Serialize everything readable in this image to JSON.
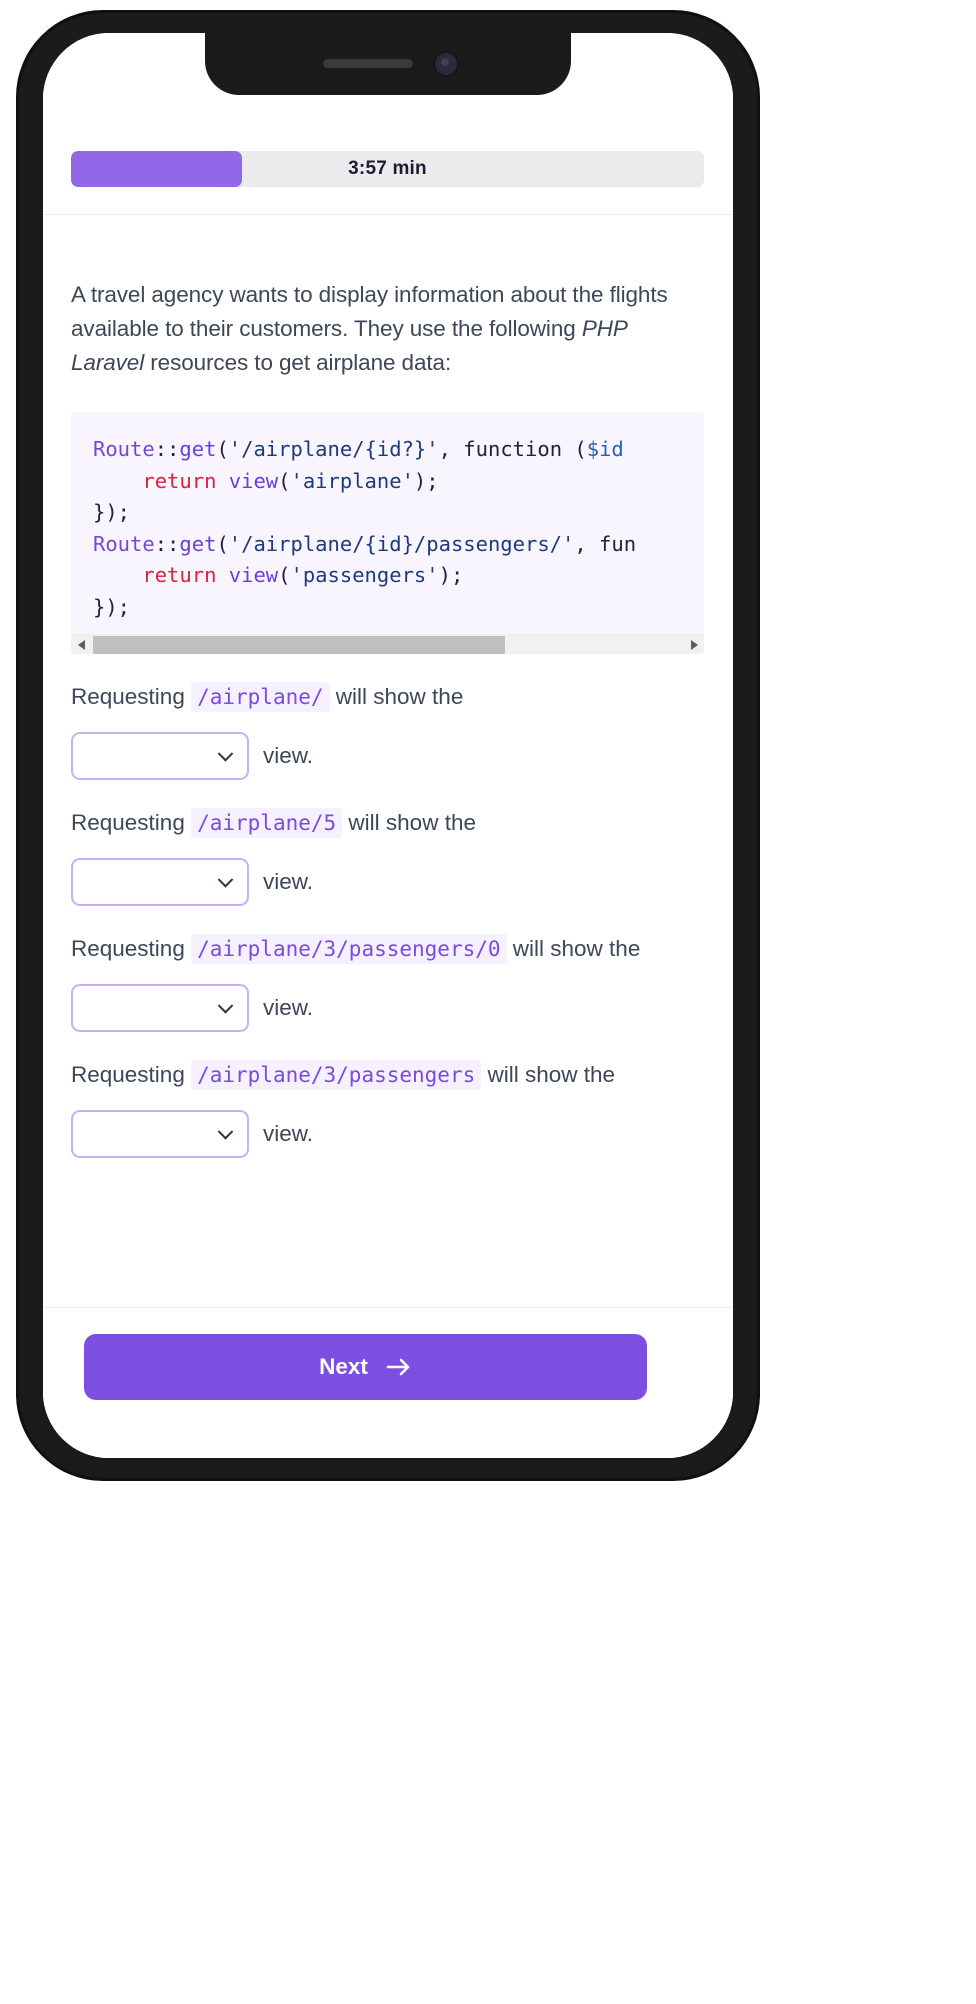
{
  "device": {
    "type": "smartphone-mockup",
    "notch_icons": [
      "speaker-grill",
      "front-camera"
    ]
  },
  "header": {
    "timer_label": "3:57 min",
    "progress_percent": 27,
    "progress_fill_color": "#9168e8",
    "progress_track_color": "#ebebee"
  },
  "prompt": {
    "part1": "A travel agency wants to display information about the flights available to their customers. They use the following ",
    "emphasis": "PHP Laravel",
    "part2": " resources to get airplane data:"
  },
  "code_block": {
    "language": "php",
    "background": "#f8f5fe",
    "lines": [
      {
        "tokens": [
          {
            "t": "Route",
            "c": "class"
          },
          {
            "t": "::",
            "c": "punct"
          },
          {
            "t": "get",
            "c": "fn"
          },
          {
            "t": "(",
            "c": "punct"
          },
          {
            "t": "'/airplane/{id?}'",
            "c": "str"
          },
          {
            "t": ", ",
            "c": "punct"
          },
          {
            "t": "function",
            "c": "punct"
          },
          {
            "t": " (",
            "c": "punct"
          },
          {
            "t": "$id",
            "c": "var"
          }
        ]
      },
      {
        "tokens": [
          {
            "t": "    ",
            "c": "punct"
          },
          {
            "t": "return",
            "c": "kw"
          },
          {
            "t": " ",
            "c": "punct"
          },
          {
            "t": "view",
            "c": "fn"
          },
          {
            "t": "(",
            "c": "punct"
          },
          {
            "t": "'airplane'",
            "c": "str"
          },
          {
            "t": ");",
            "c": "punct"
          }
        ]
      },
      {
        "tokens": [
          {
            "t": "});",
            "c": "punct"
          }
        ]
      },
      {
        "tokens": [
          {
            "t": "Route",
            "c": "class"
          },
          {
            "t": "::",
            "c": "punct"
          },
          {
            "t": "get",
            "c": "fn"
          },
          {
            "t": "(",
            "c": "punct"
          },
          {
            "t": "'/airplane/{id}/passengers/'",
            "c": "str"
          },
          {
            "t": ", ",
            "c": "punct"
          },
          {
            "t": "fun",
            "c": "punct"
          }
        ]
      },
      {
        "tokens": [
          {
            "t": "    ",
            "c": "punct"
          },
          {
            "t": "return",
            "c": "kw"
          },
          {
            "t": " ",
            "c": "punct"
          },
          {
            "t": "view",
            "c": "fn"
          },
          {
            "t": "(",
            "c": "punct"
          },
          {
            "t": "'passengers'",
            "c": "str"
          },
          {
            "t": ");",
            "c": "punct"
          }
        ]
      },
      {
        "tokens": [
          {
            "t": "});",
            "c": "punct"
          }
        ]
      }
    ],
    "scrollbar": {
      "left_arrow": "triangle-left-icon",
      "right_arrow": "triangle-right-icon",
      "thumb_fraction": 0.7
    }
  },
  "questions": [
    {
      "lead": "Requesting",
      "path": "/airplane/",
      "tail": "will show the",
      "select_value": "",
      "suffix": "view."
    },
    {
      "lead": "Requesting",
      "path": "/airplane/5",
      "tail": "will show the",
      "select_value": "",
      "suffix": "view."
    },
    {
      "lead": "Requesting",
      "path": "/airplane/3/passengers/0",
      "tail": "will show the",
      "select_value": "",
      "suffix": "view."
    },
    {
      "lead": "Requesting",
      "path": "/airplane/3/passengers",
      "tail": "will show the",
      "select_value": "",
      "suffix": "view."
    }
  ],
  "footer": {
    "next_label": "Next",
    "next_icon": "arrow-right-icon",
    "next_color": "#7c4fe0"
  }
}
